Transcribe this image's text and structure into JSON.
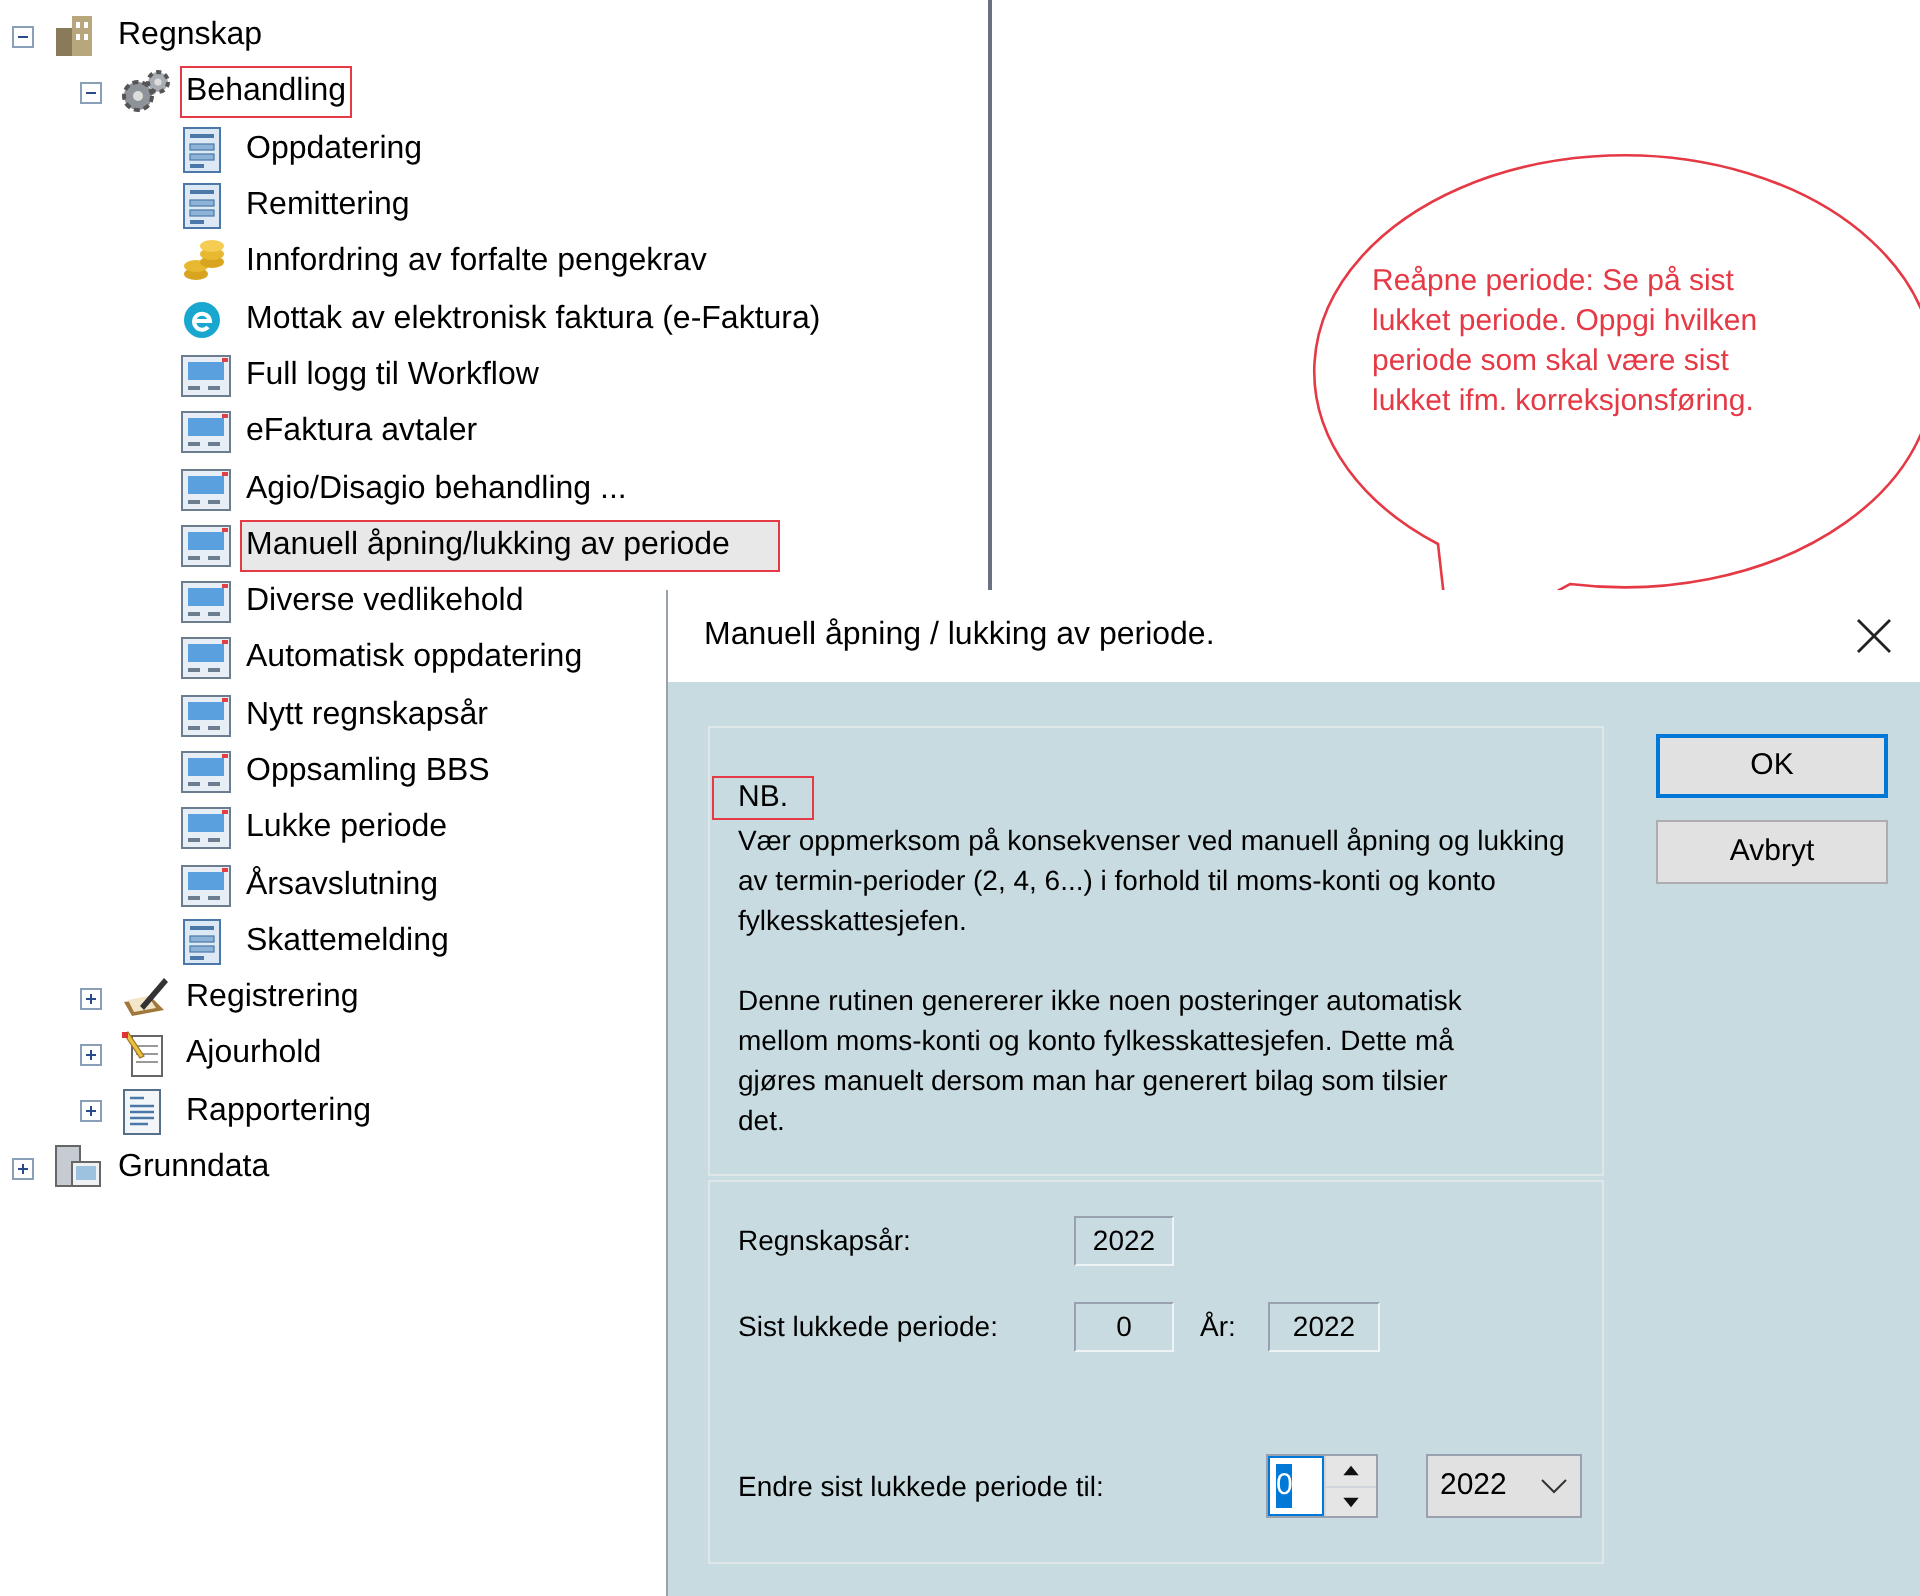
{
  "tree": [
    {
      "label": "Regnskap",
      "kind": "building",
      "expanded": true,
      "selected": false,
      "annotated": false,
      "children": [
        {
          "label": "Behandling",
          "kind": "gears",
          "expanded": true,
          "selected": false,
          "annotated": true,
          "children": [
            {
              "label": "Oppdatering",
              "kind": "form",
              "selected": false,
              "annotated": false
            },
            {
              "label": "Remittering",
              "kind": "form",
              "selected": false,
              "annotated": false
            },
            {
              "label": "Innfordring av forfalte pengekrav",
              "kind": "coins",
              "selected": false,
              "annotated": false
            },
            {
              "label": "Mottak av elektronisk faktura (e-Faktura)",
              "kind": "e-badge",
              "selected": false,
              "annotated": false
            },
            {
              "label": "Full logg til Workflow",
              "kind": "screen",
              "selected": false,
              "annotated": false
            },
            {
              "label": "eFaktura avtaler",
              "kind": "screen",
              "selected": false,
              "annotated": false
            },
            {
              "label": "Agio/Disagio behandling ...",
              "kind": "screen",
              "selected": false,
              "annotated": false
            },
            {
              "label": "Manuell åpning/lukking av periode",
              "kind": "screen",
              "selected": true,
              "annotated": true
            },
            {
              "label": "Diverse vedlikehold",
              "kind": "screen",
              "selected": false,
              "annotated": false
            },
            {
              "label": "Automatisk oppdatering",
              "kind": "screen",
              "selected": false,
              "annotated": false
            },
            {
              "label": "Nytt regnskapsår",
              "kind": "screen",
              "selected": false,
              "annotated": false
            },
            {
              "label": "Oppsamling BBS",
              "kind": "screen",
              "selected": false,
              "annotated": false
            },
            {
              "label": "Lukke periode",
              "kind": "screen",
              "selected": false,
              "annotated": false
            },
            {
              "label": "Årsavslutning",
              "kind": "screen",
              "selected": false,
              "annotated": false
            },
            {
              "label": "Skattemelding",
              "kind": "form",
              "selected": false,
              "annotated": false
            }
          ]
        },
        {
          "label": "Registrering",
          "kind": "pen",
          "expanded": false,
          "selected": false,
          "annotated": false
        },
        {
          "label": "Ajourhold",
          "kind": "notepad",
          "expanded": false,
          "selected": false,
          "annotated": false
        },
        {
          "label": "Rapportering",
          "kind": "report",
          "expanded": false,
          "selected": false,
          "annotated": false
        }
      ]
    },
    {
      "label": "Grunndata",
      "kind": "database",
      "expanded": false,
      "selected": false,
      "annotated": false
    }
  ],
  "callout": {
    "text": "Reåpne periode: Se på sist lukket periode. Oppgi hvilken periode som skal være sist lukket ifm. korreksjonsføring."
  },
  "dialog": {
    "title": "Manuell åpning / lukking av periode.",
    "notice": {
      "heading": "NB.",
      "heading_annotated": true,
      "paragraphs": [
        "Vær oppmerksom på konsekvenser ved manuell åpning og lukking av termin-perioder (2, 4, 6...) i forhold til moms-konti og konto fylkesskattesjefen.",
        "Denne rutinen genererer ikke noen posteringer automatisk mellom moms-konti og konto fylkesskattesjefen. Dette må gjøres manuelt dersom man har generert bilag som tilsier det."
      ]
    },
    "year_row": {
      "label": "Regnskapsår:",
      "value": "2022"
    },
    "last_closed_row": {
      "label": "Sist lukkede periode:",
      "value": "0",
      "year_label": "År:",
      "year_value": "2022"
    },
    "change_row": {
      "label": "Endre sist lukkede periode til:",
      "period": "0",
      "period_focused": true,
      "year": "2022"
    },
    "buttons": [
      {
        "label": "OK",
        "default": true
      },
      {
        "label": "Avbryt",
        "default": false
      }
    ]
  }
}
